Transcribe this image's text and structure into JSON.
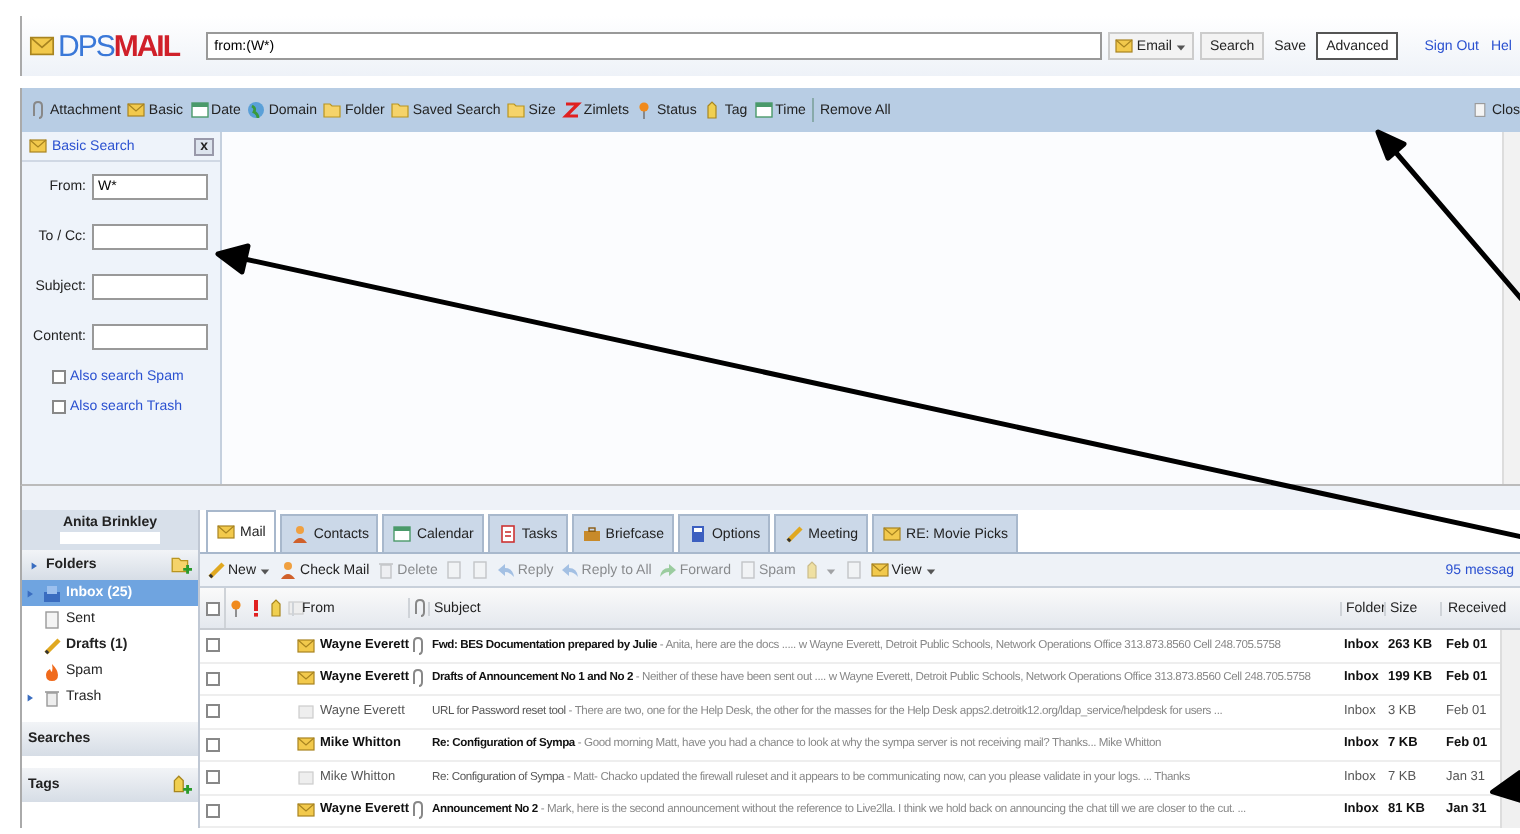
{
  "logo": {
    "prefix": "DPS",
    "suffix": "MAIL"
  },
  "search": {
    "value": "from:(W*)",
    "type_menu": "Email",
    "buttons": [
      {
        "label": "Search",
        "kind": "button",
        "selected": false
      },
      {
        "label": "Save",
        "kind": "text",
        "selected": false
      },
      {
        "label": "Advanced",
        "kind": "toggle",
        "selected": true
      }
    ]
  },
  "header_links": [
    "Sign Out",
    "Hel"
  ],
  "filter_bar": {
    "items": [
      "Attachment",
      "Basic",
      "Date",
      "Domain",
      "Folder",
      "Saved Search",
      "Size",
      "Zimlets",
      "Status",
      "Tag",
      "Time"
    ],
    "remove_all": "Remove All",
    "close": "Clos"
  },
  "basic_search": {
    "title": "Basic Search",
    "close": "x",
    "fields": [
      {
        "label": "From:",
        "value": "W*"
      },
      {
        "label": "To / Cc:"
      },
      {
        "label": "Subject:"
      },
      {
        "label": "Content:"
      }
    ],
    "options": [
      {
        "label": "Also search Spam",
        "checked": false
      },
      {
        "label": "Also search Trash",
        "checked": false
      }
    ]
  },
  "sidebar": {
    "user": "Anita Brinkley",
    "folders_title": "Folders",
    "folders": [
      {
        "label": "Inbox (25)",
        "selected": true,
        "expandable": true,
        "has_unread": true
      },
      {
        "label": "Sent",
        "selected": false,
        "expandable": false,
        "has_unread": false
      },
      {
        "label": "Drafts (1)",
        "selected": false,
        "expandable": false,
        "has_unread": true
      },
      {
        "label": "Spam",
        "selected": false,
        "expandable": false,
        "has_unread": false
      },
      {
        "label": "Trash",
        "selected": false,
        "expandable": true,
        "has_unread": false
      }
    ],
    "sections": [
      "Searches",
      "Tags"
    ]
  },
  "tabs": [
    {
      "label": "Mail",
      "selected": true
    },
    {
      "label": "Contacts",
      "selected": false
    },
    {
      "label": "Calendar",
      "selected": false
    },
    {
      "label": "Tasks",
      "selected": false
    },
    {
      "label": "Briefcase",
      "selected": false
    },
    {
      "label": "Options",
      "selected": false
    },
    {
      "label": "Meeting",
      "selected": false
    },
    {
      "label": "RE: Movie Picks",
      "selected": false
    }
  ],
  "toolbar": [
    {
      "kind": "button",
      "label": "New",
      "dropdown": true,
      "disabled": false
    },
    {
      "kind": "button",
      "label": "Check Mail",
      "dropdown": false,
      "disabled": false
    },
    {
      "kind": "button",
      "label": "Delete",
      "dropdown": false,
      "disabled": true
    },
    {
      "kind": "icon",
      "dropdown": false,
      "disabled": true
    },
    {
      "kind": "icon",
      "dropdown": false,
      "disabled": true
    },
    {
      "kind": "button",
      "label": "Reply",
      "dropdown": false,
      "disabled": true
    },
    {
      "kind": "button",
      "label": "Reply to All",
      "dropdown": false,
      "disabled": true
    },
    {
      "kind": "button",
      "label": "Forward",
      "dropdown": false,
      "disabled": true
    },
    {
      "kind": "button",
      "label": "Spam",
      "dropdown": false,
      "disabled": true
    },
    {
      "kind": "icon",
      "dropdown": true,
      "disabled": true
    },
    {
      "kind": "icon",
      "dropdown": false,
      "disabled": true
    },
    {
      "kind": "button",
      "label": "View",
      "dropdown": true,
      "disabled": false
    }
  ],
  "message_count": "95 messag",
  "columns": [
    "From",
    "Subject",
    "Folder",
    "Size",
    "Received"
  ],
  "select_all_checked": false,
  "messages": [
    {
      "from": "Wayne Everett",
      "subject": "Fwd: BES Documentation prepared by Julie",
      "preview": "- Anita, here are the docs ..... w Wayne Everett, Detroit Public Schools, Network Operations Office 313.873.8560 Cell 248.705.5758",
      "folder": "Inbox",
      "size": "263 KB",
      "received": "Feb 01",
      "unread": true,
      "attachment": true
    },
    {
      "from": "Wayne Everett",
      "subject": "Drafts of Announcement No 1 and No 2",
      "preview": "- Neither of these have been sent out .... w Wayne Everett, Detroit Public Schools, Network Operations Office 313.873.8560 Cell 248.705.5758",
      "folder": "Inbox",
      "size": "199 KB",
      "received": "Feb 01",
      "unread": true,
      "attachment": true
    },
    {
      "from": "Wayne Everett",
      "subject": "URL for Password reset tool",
      "preview": "- There are two, one for the Help Desk, the other for the masses for the Help Desk apps2.detroitk12.org/ldap_service/helpdesk for users ...",
      "folder": "Inbox",
      "size": "3 KB",
      "received": "Feb 01",
      "unread": false,
      "attachment": false
    },
    {
      "from": "Mike Whitton",
      "subject": "Re: Configuration of Sympa",
      "preview": "- Good morning Matt, have you had a chance to look at why the sympa server is not receiving mail? Thanks... Mike Whitton",
      "folder": "Inbox",
      "size": "7 KB",
      "received": "Feb 01",
      "unread": true,
      "attachment": false
    },
    {
      "from": "Mike Whitton",
      "subject": "Re: Configuration of Sympa",
      "preview": "- Matt- Chacko updated the firewall ruleset and it appears to be communicating now, can you please validate in your logs. ... Thanks",
      "folder": "Inbox",
      "size": "7 KB",
      "received": "Jan 31",
      "unread": false,
      "attachment": false
    },
    {
      "from": "Wayne Everett",
      "subject": "Announcement No 2",
      "preview": "- Mark, here is the second announcement without the reference to Live2lla. I think we hold back on announcing the chat till we are closer to the cut. ...",
      "folder": "Inbox",
      "size": "81 KB",
      "received": "Jan 31",
      "unread": true,
      "attachment": true
    }
  ]
}
